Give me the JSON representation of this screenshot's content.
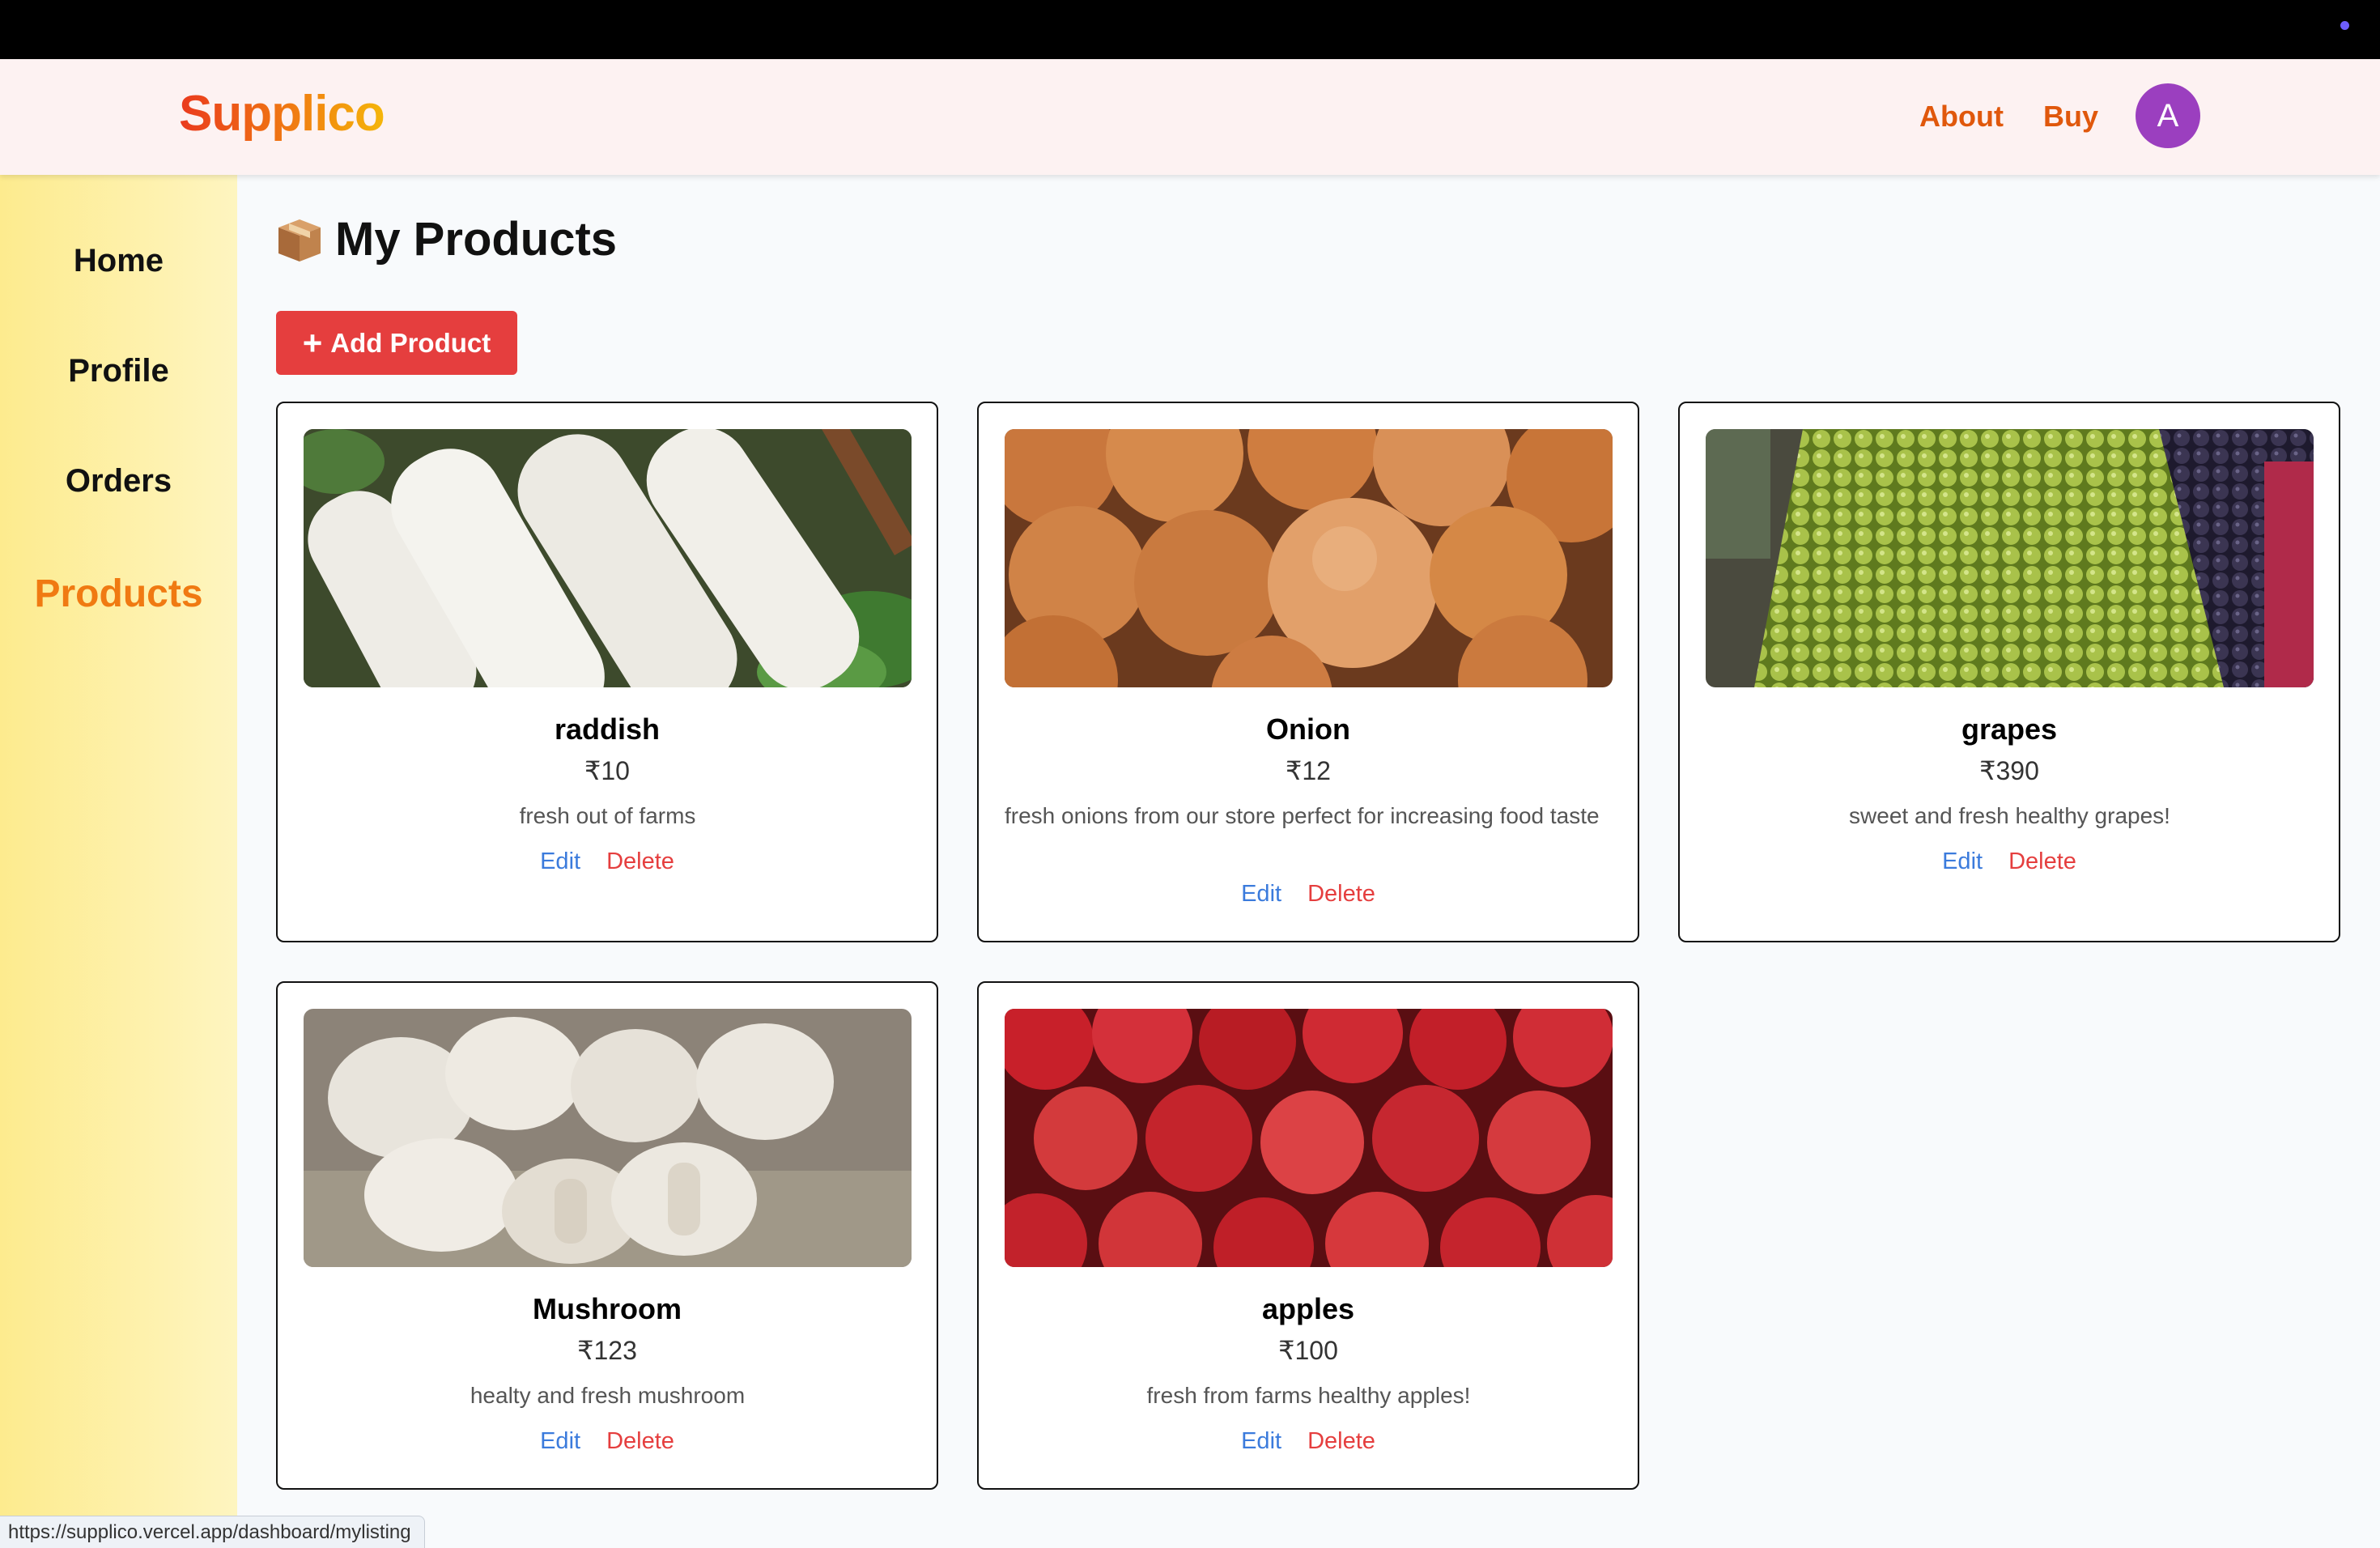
{
  "app": {
    "logo": "Supplico"
  },
  "header": {
    "nav": [
      "About",
      "Buy"
    ],
    "avatar_letter": "A"
  },
  "sidebar": {
    "items": [
      "Home",
      "Profile",
      "Orders",
      "Products"
    ],
    "active": "Products"
  },
  "page": {
    "title": "My Products",
    "add_button": "Add Product"
  },
  "products": [
    {
      "name": "raddish",
      "price": "₹10",
      "description": "fresh out of farms",
      "image": "raddish-photo"
    },
    {
      "name": "Onion",
      "price": "₹12",
      "description": "fresh onions from our store perfect for increasing food taste",
      "image": "onion-photo"
    },
    {
      "name": "grapes",
      "price": "₹390",
      "description": "sweet and fresh healthy grapes!",
      "image": "grapes-photo"
    },
    {
      "name": "Mushroom",
      "price": "₹123",
      "description": "healty and fresh mushroom",
      "image": "mushroom-photo"
    },
    {
      "name": "apples",
      "price": "₹100",
      "description": "fresh from farms healthy apples!",
      "image": "apples-photo"
    }
  ],
  "actions": {
    "edit": "Edit",
    "delete": "Delete"
  },
  "status_bar": {
    "url": "https://supplico.vercel.app/dashboard/mylisting"
  },
  "colors": {
    "accent": "#e0580c",
    "add_button": "#e53e3e",
    "edit_link": "#3b7bdc",
    "delete_link": "#e53e3e",
    "avatar": "#9b3fbf"
  }
}
